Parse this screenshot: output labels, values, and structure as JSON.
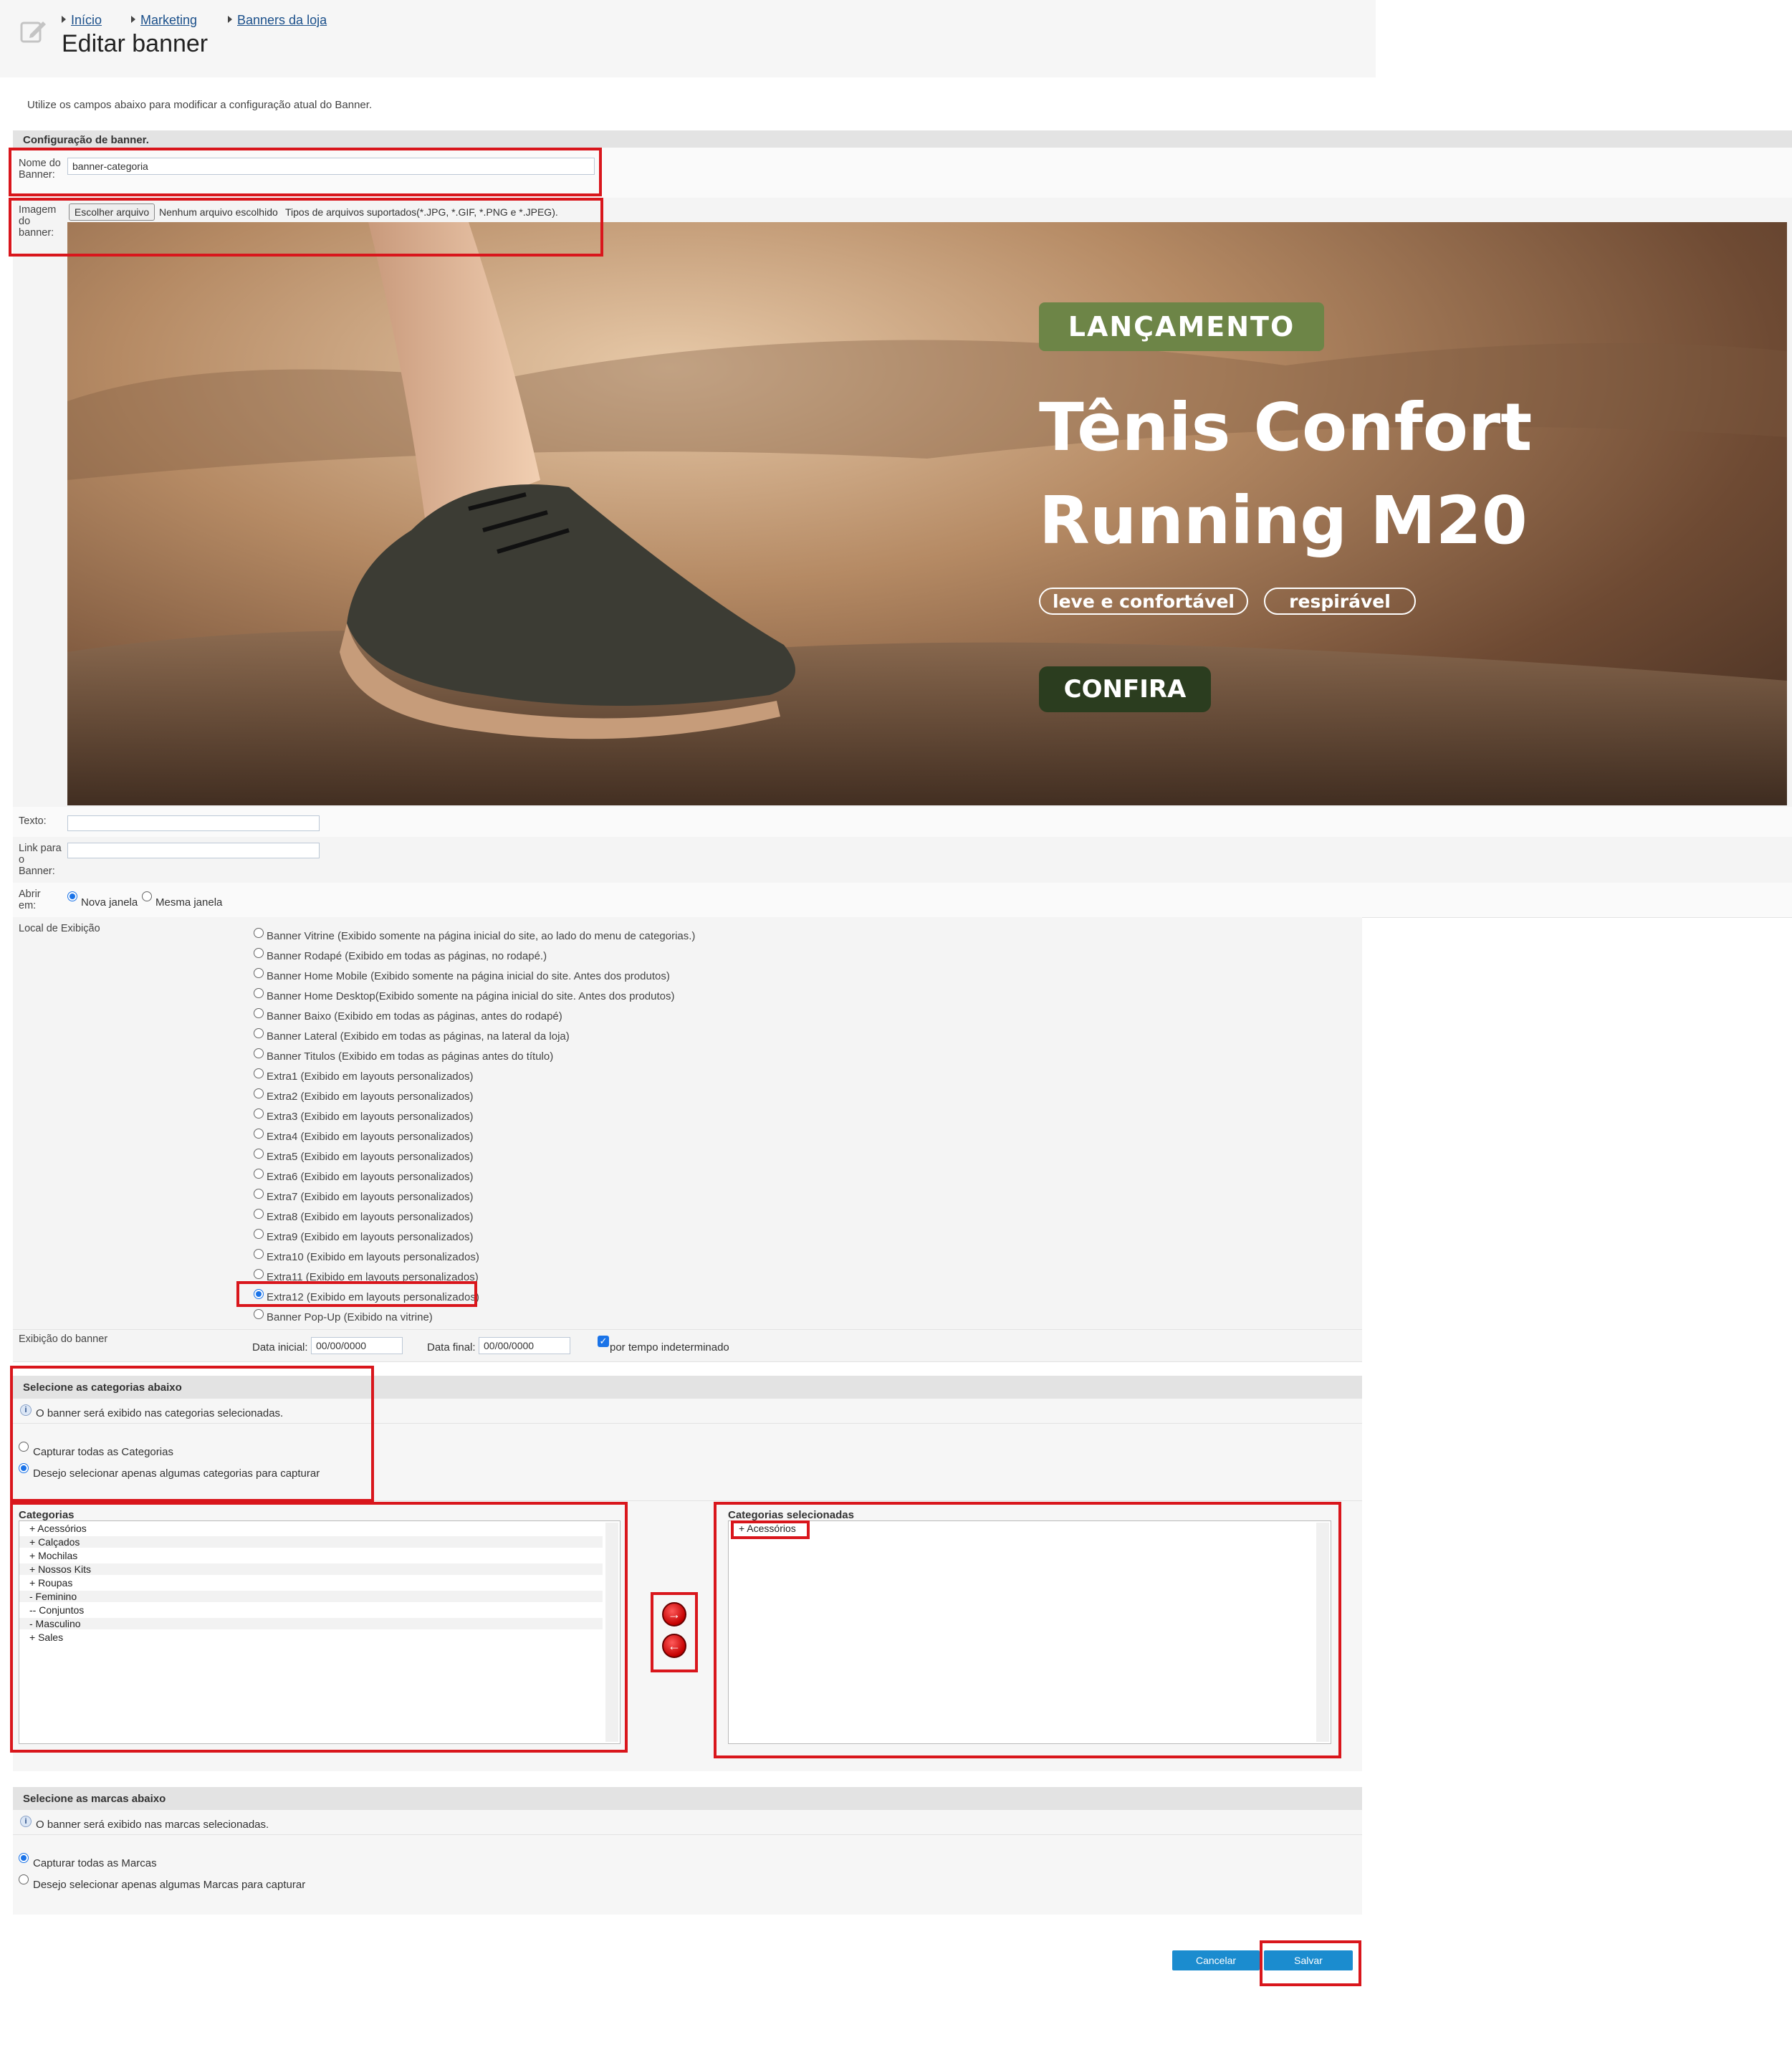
{
  "breadcrumb": [
    "Início",
    "Marketing",
    "Banners da loja"
  ],
  "page_title": "Editar banner",
  "intro": "Utilize os campos abaixo para modificar a configuração atual do Banner.",
  "config": {
    "section_title": "Configuração de banner.",
    "name_label": "Nome do Banner:",
    "name_value": "banner-categoria",
    "image_label": "Imagem do banner:",
    "file_button": "Escolher arquivo",
    "file_status": "Nenhum arquivo escolhido",
    "file_types": "Tipos de arquivos suportados(*.JPG, *.GIF, *.PNG e *.JPEG).",
    "text_label": "Texto:",
    "text_value": "",
    "link_label": "Link para o Banner:",
    "link_value": "",
    "open_label": "Abrir em:",
    "open_options": [
      "Nova janela",
      "Mesma janela"
    ],
    "open_selected": "Nova janela"
  },
  "banner_image": {
    "tag": "LANÇAMENTO",
    "headline_1": "Tênis Confort",
    "headline_2": "Running M20",
    "pill_1": "leve e confortável",
    "pill_2": "respirável",
    "cta": "CONFIRA"
  },
  "location": {
    "label": "Local de Exibição",
    "options": [
      "Banner Vitrine (Exibido somente na página inicial do site, ao lado do menu de categorias.)",
      "Banner Rodapé (Exibido em todas as páginas, no rodapé.)",
      "Banner Home Mobile (Exibido somente na página inicial do site. Antes dos produtos)",
      "Banner Home Desktop(Exibido somente na página inicial do site. Antes dos produtos)",
      "Banner Baixo (Exibido em todas as páginas, antes do rodapé)",
      "Banner Lateral (Exibido em todas as páginas, na lateral da loja)",
      "Banner Titulos (Exibido em todas as páginas antes do título)",
      "Extra1 (Exibido em layouts personalizados)",
      "Extra2 (Exibido em layouts personalizados)",
      "Extra3 (Exibido em layouts personalizados)",
      "Extra4 (Exibido em layouts personalizados)",
      "Extra5 (Exibido em layouts personalizados)",
      "Extra6 (Exibido em layouts personalizados)",
      "Extra7 (Exibido em layouts personalizados)",
      "Extra8 (Exibido em layouts personalizados)",
      "Extra9 (Exibido em layouts personalizados)",
      "Extra10 (Exibido em layouts personalizados)",
      "Extra11 (Exibido em layouts personalizados)",
      "Extra12 (Exibido em layouts personalizados)",
      "Banner Pop-Up (Exibido na vitrine)"
    ],
    "selected": "Extra12 (Exibido em layouts personalizados)"
  },
  "display": {
    "label": "Exibição do banner",
    "start_label": "Data inicial:",
    "start_value": "00/00/0000",
    "end_label": "Data final:",
    "end_value": "00/00/0000",
    "indefinite_label": "por tempo indeterminado",
    "indefinite_checked": true
  },
  "categories": {
    "section_title": "Selecione as categorias abaixo",
    "info": "O banner será exibido nas categorias selecionadas.",
    "option_all": "Capturar todas as Categorias",
    "option_some": "Desejo selecionar apenas algumas categorias para capturar",
    "selected_option": "Desejo selecionar apenas algumas categorias para capturar",
    "list_title": "Categorias",
    "list": [
      "+ Acessórios",
      "+ Calçados",
      "+ Mochilas",
      "+ Nossos Kits",
      "+ Roupas",
      "- Feminino",
      "-- Conjuntos",
      "- Masculino",
      "+ Sales"
    ],
    "selected_title": "Categorias selecionadas",
    "selected_list": [
      "+ Acessórios"
    ]
  },
  "brands": {
    "section_title": "Selecione as marcas abaixo",
    "info": "O banner será exibido nas marcas selecionadas.",
    "option_all": "Capturar todas as Marcas",
    "option_some": "Desejo selecionar apenas algumas Marcas para capturar",
    "selected_option": "Capturar todas as Marcas"
  },
  "actions": {
    "cancel": "Cancelar",
    "save": "Salvar"
  },
  "colors": {
    "highlight": "#d9161c",
    "button": "#1b8ccf",
    "tag_green": "#6d8547",
    "cta_green": "#2b3d1f"
  }
}
